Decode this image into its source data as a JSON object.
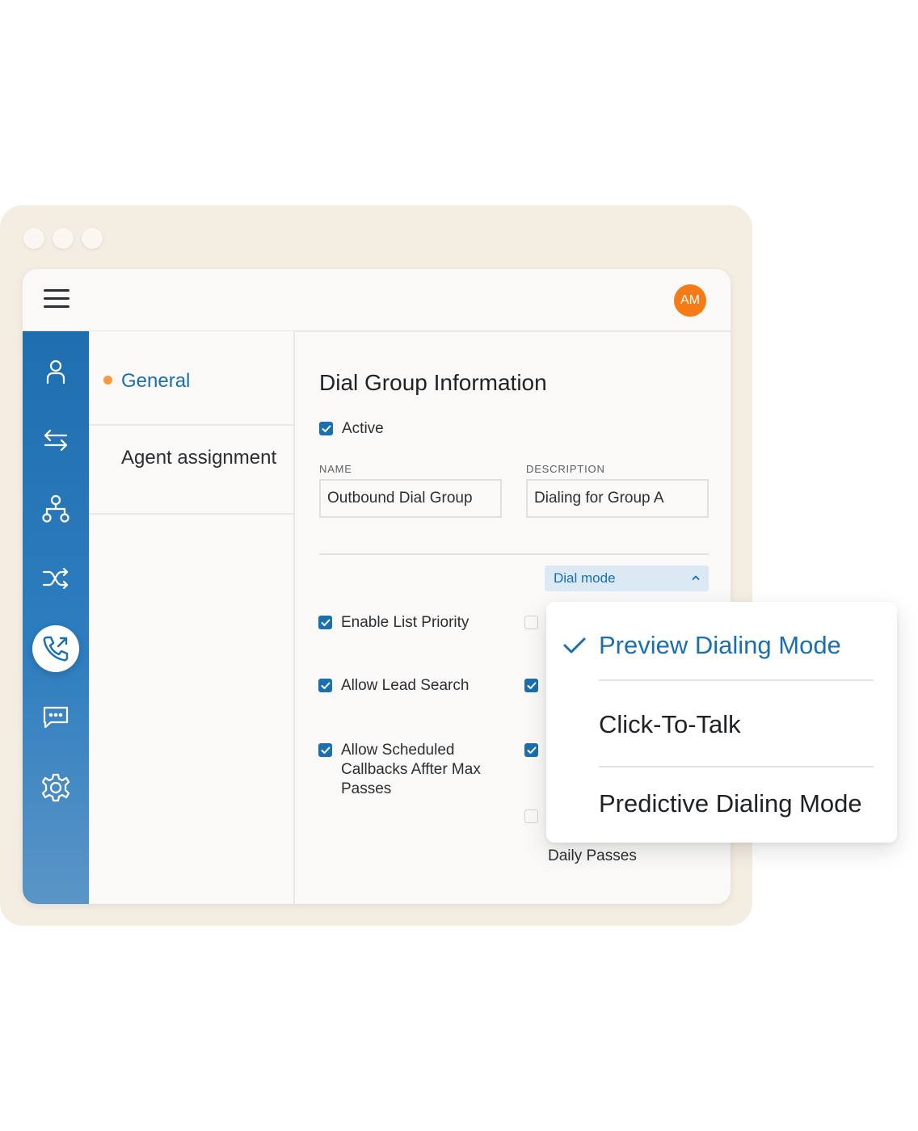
{
  "window": {
    "avatar_initials": "AM"
  },
  "colors": {
    "accent": "#1a6fb0",
    "rail_gradient_top": "#1f6fb0",
    "rail_gradient_bottom": "#5b95c7",
    "avatar_bg": "#f47b16",
    "frame_bg": "#f4ede2",
    "active_dot": "#f79a3c"
  },
  "rail": {
    "icons": [
      "user-icon",
      "transfer-arrows-icon",
      "hierarchy-icon",
      "shuffle-icon",
      "phone-call-icon",
      "chat-icon",
      "gear-icon"
    ],
    "active": "phone-call-icon"
  },
  "subnav": {
    "items": [
      {
        "label": "General",
        "active": true
      },
      {
        "label": "Agent assignment",
        "active": false
      }
    ]
  },
  "main": {
    "title": "Dial Group Information",
    "active_label": "Active",
    "name_label": "NAME",
    "name_value": "Outbound Dial Group",
    "description_label": "DESCRIPTION",
    "description_value": "Dialing for Group A",
    "dial_mode_label": "Dial mode",
    "checkboxes_left": [
      {
        "label": "Enable List Priority",
        "checked": true
      },
      {
        "label": "Allow Lead Search",
        "checked": true
      },
      {
        "label": "Allow Scheduled Callbacks Affter Max Passes",
        "checked": true
      }
    ],
    "checkboxes_right_checked": [
      false,
      true,
      true,
      false
    ],
    "partial_label": "Daily Passes"
  },
  "dial_mode_menu": {
    "options": [
      {
        "label": "Preview Dialing Mode",
        "selected": true
      },
      {
        "label": "Click-To-Talk",
        "selected": false
      },
      {
        "label": "Predictive Dialing Mode",
        "selected": false
      }
    ]
  }
}
